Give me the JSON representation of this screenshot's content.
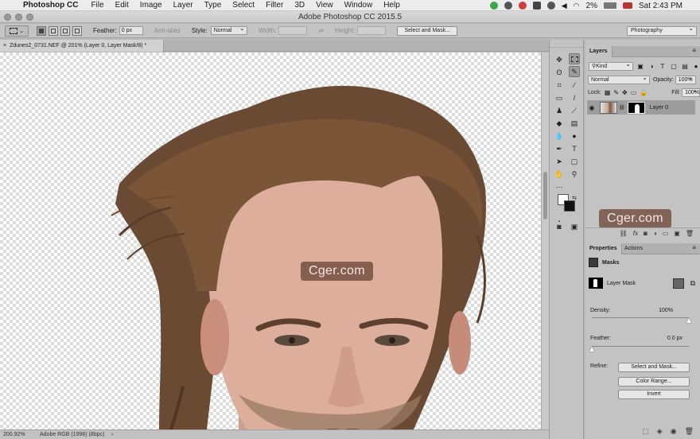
{
  "menubar": {
    "app": "Photoshop CC",
    "items": [
      "File",
      "Edit",
      "Image",
      "Layer",
      "Type",
      "Select",
      "Filter",
      "3D",
      "View",
      "Window",
      "Help"
    ],
    "battery": "2%",
    "clock": "Sat 2:43 PM"
  },
  "window": {
    "title": "Adobe Photoshop CC 2015.5"
  },
  "options": {
    "feather_label": "Feather:",
    "feather_value": "0 px",
    "antialias_label": "Anti-alias",
    "style_label": "Style:",
    "style_value": "Normal",
    "width_label": "Width:",
    "height_label": "Height:",
    "select_mask_label": "Select and Mask...",
    "workspace": "Photography"
  },
  "document": {
    "tab_title": "Zdunes2_0731.NEF @ 201% (Layer 0, Layer Mask/8) *",
    "watermark": "Cger.com"
  },
  "status": {
    "zoom": "200.92%",
    "profile": "Adobe RGB (1998) (8bpc)",
    "arrow": "›"
  },
  "layers": {
    "tab": "Layers",
    "filter_kind": "Kind",
    "blend_mode": "Normal",
    "opacity_label": "Opacity:",
    "opacity_value": "100%",
    "lock_label": "Lock:",
    "fill_label": "Fill:",
    "fill_value": "100%",
    "layer_name": "Layer 0"
  },
  "properties": {
    "tab_properties": "Properties",
    "tab_actions": "Actions",
    "section": "Masks",
    "mask_label": "Layer Mask",
    "density_label": "Density:",
    "density_value": "100%",
    "density_level": 1.0,
    "feather_label": "Feather:",
    "feather_value": "0.0 px",
    "feather_level": 0.0,
    "refine_label": "Refine:",
    "select_mask_btn": "Select and Mask...",
    "color_range_btn": "Color Range...",
    "invert_btn": "Invert"
  }
}
